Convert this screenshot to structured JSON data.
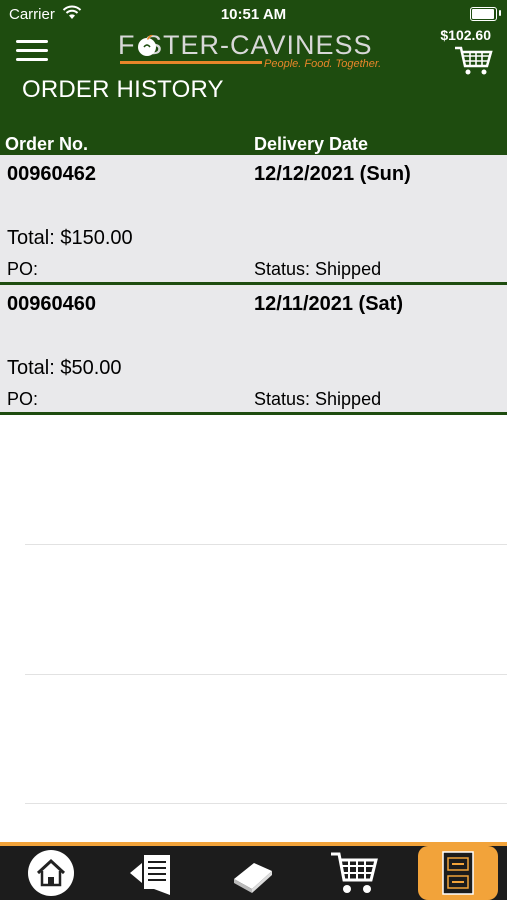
{
  "status_bar": {
    "carrier": "Carrier",
    "time": "10:51 AM"
  },
  "header": {
    "logo_text": "F  STER-CAVINESS",
    "logo_tagline": "People. Food. Together.",
    "cart_amount": "$102.60",
    "title": "ORDER HISTORY",
    "columns": {
      "order": "Order No.",
      "date": "Delivery Date"
    }
  },
  "orders": [
    {
      "number": "00960462",
      "date": "12/12/2021 (Sun)",
      "total": "Total: $150.00",
      "po": "PO:",
      "status": "Status: Shipped"
    },
    {
      "number": "00960460",
      "date": "12/11/2021 (Sat)",
      "total": "Total: $50.00",
      "po": "PO:",
      "status": "Status: Shipped"
    }
  ],
  "tabbar": {
    "items": [
      "home-icon",
      "order-list-icon",
      "catalog-book-icon",
      "cart-icon",
      "order-history-icon"
    ],
    "active": "order-history-icon"
  },
  "colors": {
    "header_green": "#1e4c0f",
    "accent_orange": "#f2a33a",
    "row_gray": "#e9e9eb"
  }
}
